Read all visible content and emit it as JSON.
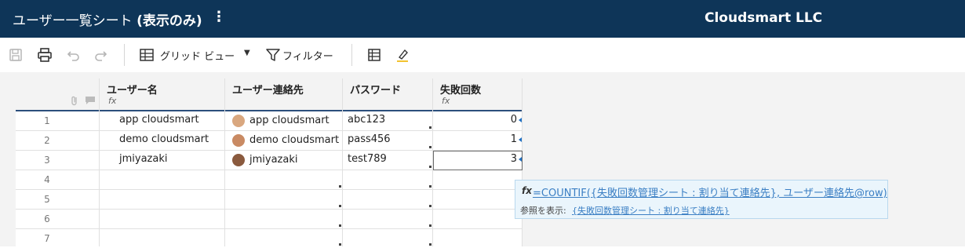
{
  "header": {
    "title_prefix": "ユーザー一覧シート ",
    "title_suffix": "(表示のみ)",
    "menu_glyph": "⋮",
    "company": "Cloudsmart LLC"
  },
  "toolbar": {
    "save_icon": "save-icon",
    "print_icon": "print-icon",
    "undo_icon": "undo-icon",
    "redo_icon": "redo-icon",
    "view_label": "グリッド ビュー",
    "view_caret": "▼",
    "filter_label": "フィルター",
    "grid_icon": "grid-icon",
    "highlight_icon": "highlight-icon"
  },
  "columns": [
    {
      "label": "ユーザー名",
      "has_fx": true
    },
    {
      "label": "ユーザー連絡先",
      "has_fx": false
    },
    {
      "label": "パスワード",
      "has_fx": false
    },
    {
      "label": "失敗回数",
      "has_fx": true
    }
  ],
  "fx_glyph": "fx",
  "rows": [
    {
      "num": "1",
      "name": "app cloudsmart",
      "contact": "app cloudsmart",
      "password": "abc123",
      "failures": "0"
    },
    {
      "num": "2",
      "name": "demo cloudsmart",
      "contact": "demo cloudsmart",
      "password": "pass456",
      "failures": "1"
    },
    {
      "num": "3",
      "name": "jmiyazaki",
      "contact": "jmiyazaki",
      "password": "test789",
      "failures": "3"
    },
    {
      "num": "4"
    },
    {
      "num": "5"
    },
    {
      "num": "6"
    },
    {
      "num": "7"
    }
  ],
  "tooltip": {
    "fx_glyph": "fx",
    "formula": "=COUNTIF({失敗回数管理シート : 割り当て連絡先}, ユーザー連絡先@row)",
    "ref_label": "参照を表示:",
    "ref_link": "{失敗回数管理シート : 割り当て連絡先}"
  },
  "colors": {
    "header_bg": "#0e3558",
    "accent": "#1e6fc2",
    "link": "#3b7fc4"
  }
}
